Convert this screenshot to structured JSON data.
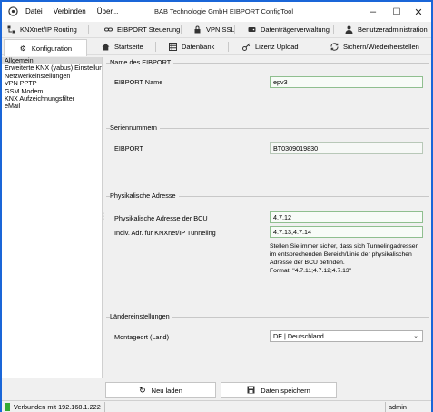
{
  "window": {
    "title": "BAB Technologie GmbH EIBPORT ConfigTool",
    "controls": {
      "minimize": "–",
      "maximize": "☐",
      "close": "✕"
    }
  },
  "menu": [
    "Datei",
    "Verbinden",
    "Über..."
  ],
  "toolbar_row1": [
    {
      "label": "KNXnet/IP Routing",
      "icon": "network-icon"
    },
    {
      "label": "EIBPORT Steuerung",
      "icon": "link-icon"
    },
    {
      "label": "VPN SSL",
      "icon": "lock-icon"
    },
    {
      "label": "Datenträgerverwaltung",
      "icon": "disk-icon"
    },
    {
      "label": "Benutzeradministration",
      "icon": "user-icon"
    }
  ],
  "toolbar_row2": [
    {
      "label": "Konfiguration",
      "icon": "gear-icon",
      "active": true
    },
    {
      "label": "Startseite",
      "icon": "home-icon",
      "active": false
    },
    {
      "label": "Datenbank",
      "icon": "database-icon",
      "active": false
    },
    {
      "label": "Lizenz Upload",
      "icon": "key-icon",
      "active": false
    },
    {
      "label": "Sichern/Wiederherstellen",
      "icon": "sync-icon",
      "active": false
    }
  ],
  "sidebar": {
    "items": [
      "Allgemein",
      "Erweiterte KNX (yabus) Einstellungen",
      "Netzwerkeinstellungen",
      "VPN PPTP",
      "GSM Modem",
      "KNX Aufzeichnungsfilter",
      "eMail"
    ],
    "selected_index": 0
  },
  "groups": {
    "name": {
      "title": "Name des EIBPORT",
      "label": "EIBPORT Name",
      "value": "epv3"
    },
    "serial": {
      "title": "Seriennummern",
      "label": "EIBPORT",
      "value": "BT0309019830"
    },
    "physical": {
      "title": "Physikalische Adresse",
      "bcu_label": "Physikalische Adresse der BCU",
      "bcu_value": "4.7.12",
      "tunnel_label": "Indiv. Adr. für KNXnet/IP Tunneling",
      "tunnel_value": "4.7.13;4.7.14",
      "note_lines": [
        "Stellen Sie immer sicher, dass sich Tunnelingadressen",
        "im entsprechenden Bereich/Linie der physikalischen",
        "Adresse der BCU befinden.",
        "Format: \"4.7.11;4.7.12;4.7.13\""
      ]
    },
    "country": {
      "title": "Ländereinstellungen",
      "label": "Montageort (Land)",
      "value": "DE | Deutschland"
    }
  },
  "buttons": {
    "reload": {
      "label": "Neu laden",
      "icon": "refresh-icon"
    },
    "save": {
      "label": "Daten speichern",
      "icon": "save-icon"
    }
  },
  "status": {
    "connection": "Verbunden mit 192.168.1.222",
    "user": "admin",
    "led_color": "#33aa33"
  },
  "colors": {
    "window_border": "#1a66d8",
    "input_border": "#8fbf8f"
  }
}
